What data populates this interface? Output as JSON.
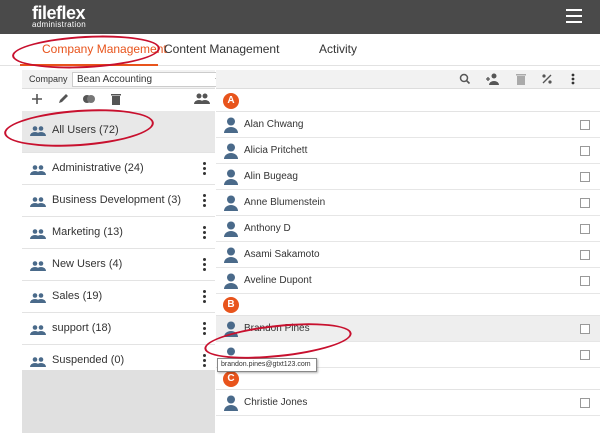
{
  "app": {
    "logo_main": "fileflex",
    "logo_sub": "administration"
  },
  "tabs": [
    {
      "label": "Company Management",
      "active": true
    },
    {
      "label": "Content Management",
      "active": false
    },
    {
      "label": "Activity",
      "active": false
    }
  ],
  "company": {
    "label": "Company",
    "selected": "Bean Accounting"
  },
  "groups": [
    {
      "label": "All Users (72)",
      "selected": true
    },
    {
      "label": "Administrative (24)"
    },
    {
      "label": "Business Development (3)"
    },
    {
      "label": "Marketing (13)"
    },
    {
      "label": "New Users (4)"
    },
    {
      "label": "Sales (19)"
    },
    {
      "label": "support (18)"
    },
    {
      "label": "Suspended (0)"
    }
  ],
  "sections": [
    {
      "letter": "A",
      "users": [
        "Alan Chwang",
        "Alicia Pritchett",
        "Alin Bugeag",
        "Anne Blumenstein",
        "Anthony D",
        "Asami Sakamoto",
        "Aveline Dupont"
      ]
    },
    {
      "letter": "B",
      "users": [
        "Brandon Pines",
        ""
      ]
    },
    {
      "letter": "C",
      "users": [
        "Christie Jones"
      ]
    }
  ],
  "tooltip": {
    "text": "brandon.pines@gtxt123.com"
  },
  "colors": {
    "accent": "#e8541c",
    "header": "#4a4a4a",
    "annotation": "#c8102e",
    "icon": "#4a6a8a"
  }
}
